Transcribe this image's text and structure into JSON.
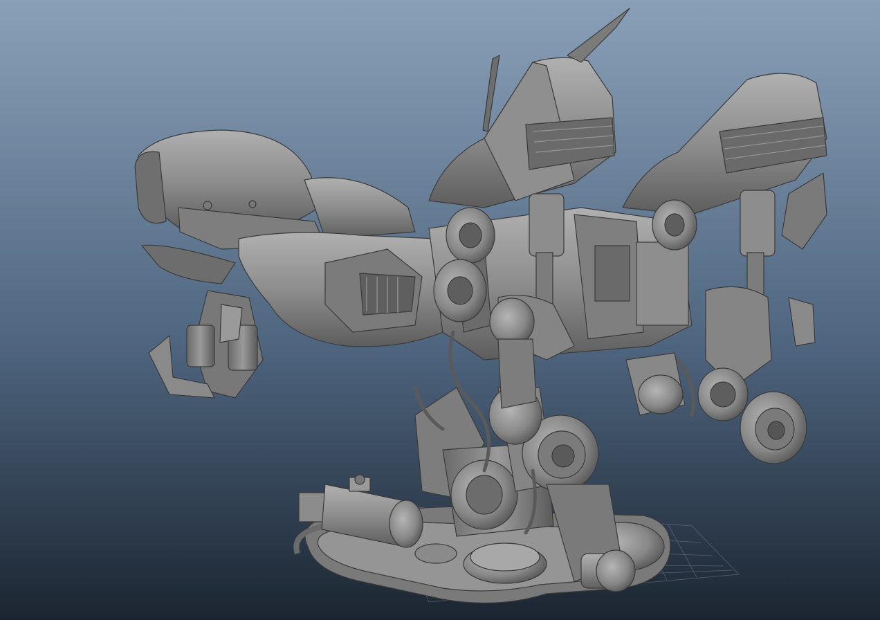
{
  "viewport": {
    "background_top": "#8aa0b8",
    "background_mid": "#4f6680",
    "background_bottom": "#1b2530",
    "model_fill": "#8b8b8b",
    "model_light": "#a9a9a9",
    "model_dark": "#5a5a5a",
    "model_shadow": "#3c3c3c",
    "grid_color": "#7c8793",
    "grid_visible": true,
    "shading_mode": "smooth-shaded",
    "model_subject": "mechanical-dragon-mech"
  }
}
